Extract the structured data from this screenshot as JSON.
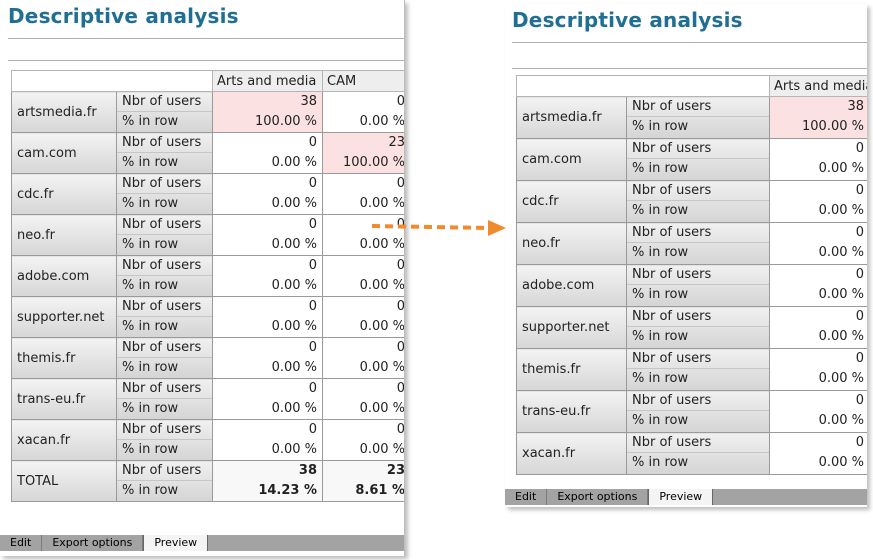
{
  "title": "Descriptive analysis",
  "columns": [
    "Arts and media",
    "CAM"
  ],
  "measures": [
    "Nbr of users",
    "% in row"
  ],
  "rows": [
    {
      "domain": "artsmedia.fr",
      "values": [
        {
          "count": "38",
          "pct": "100.00 %"
        },
        {
          "count": "0",
          "pct": "0.00 %"
        }
      ]
    },
    {
      "domain": "cam.com",
      "values": [
        {
          "count": "0",
          "pct": "0.00 %"
        },
        {
          "count": "23",
          "pct": "100.00 %"
        }
      ]
    },
    {
      "domain": "cdc.fr",
      "values": [
        {
          "count": "0",
          "pct": "0.00 %"
        },
        {
          "count": "0",
          "pct": "0.00 %"
        }
      ]
    },
    {
      "domain": "neo.fr",
      "values": [
        {
          "count": "0",
          "pct": "0.00 %"
        },
        {
          "count": "0",
          "pct": "0.00 %"
        }
      ]
    },
    {
      "domain": "adobe.com",
      "values": [
        {
          "count": "0",
          "pct": "0.00 %"
        },
        {
          "count": "0",
          "pct": "0.00 %"
        }
      ]
    },
    {
      "domain": "supporter.net",
      "values": [
        {
          "count": "0",
          "pct": "0.00 %"
        },
        {
          "count": "0",
          "pct": "0.00 %"
        }
      ]
    },
    {
      "domain": "themis.fr",
      "values": [
        {
          "count": "0",
          "pct": "0.00 %"
        },
        {
          "count": "0",
          "pct": "0.00 %"
        }
      ]
    },
    {
      "domain": "trans-eu.fr",
      "values": [
        {
          "count": "0",
          "pct": "0.00 %"
        },
        {
          "count": "0",
          "pct": "0.00 %"
        }
      ]
    },
    {
      "domain": "xacan.fr",
      "values": [
        {
          "count": "0",
          "pct": "0.00 %"
        },
        {
          "count": "0",
          "pct": "0.00 %"
        }
      ]
    }
  ],
  "total": {
    "label": "TOTAL",
    "values": [
      {
        "count": "38",
        "pct": "14.23 %"
      },
      {
        "count": "23",
        "pct": "8.61 %"
      }
    ]
  },
  "tabs": [
    "Edit",
    "Export options",
    "Preview"
  ],
  "active_tab": "Preview",
  "highlight_color": "#fbe1e1",
  "title_color": "#1f6e93",
  "arrow_color": "#f08a2c",
  "arrow_icon": "dashed-arrow-right-icon"
}
